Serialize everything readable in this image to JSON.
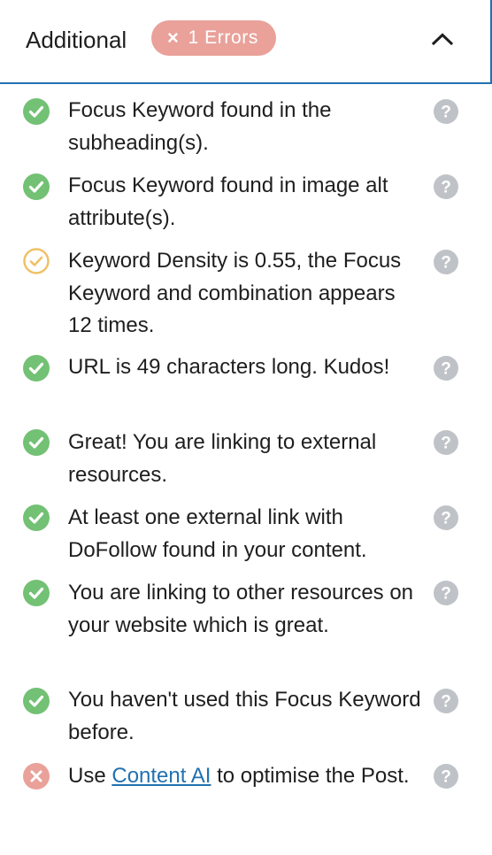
{
  "header": {
    "title": "Additional",
    "error_badge": {
      "icon": "x-icon",
      "label": "1 Errors",
      "color": "#e9a19a"
    },
    "collapse_icon": "chevron-up-icon",
    "border_color": "#2271b1"
  },
  "colors": {
    "ok": "#72c174",
    "warning": "#f0c167",
    "error": "#e9a19a",
    "help": "#bfc3c8",
    "link": "#2271b1"
  },
  "checks": [
    {
      "status": "ok",
      "icon": "check-circle-icon",
      "text": "Focus Keyword found in the subheading(s)."
    },
    {
      "status": "ok",
      "icon": "check-circle-icon",
      "text": "Focus Keyword found in image alt attribute(s)."
    },
    {
      "status": "warning",
      "icon": "warning-circle-icon",
      "text": "Keyword Density is 0.55, the Focus Keyword and combination appears 12 times."
    },
    {
      "status": "ok",
      "icon": "check-circle-icon",
      "text": "URL is 49 characters long. Kudos!"
    },
    {
      "status": "ok",
      "icon": "check-circle-icon",
      "text": "Great! You are linking to external resources."
    },
    {
      "status": "ok",
      "icon": "check-circle-icon",
      "text": "At least one external link with DoFollow found in your content."
    },
    {
      "status": "ok",
      "icon": "check-circle-icon",
      "text": "You are linking to other resources on your website which is great."
    },
    {
      "status": "ok",
      "icon": "check-circle-icon",
      "text": "You haven't used this Focus Keyword before."
    },
    {
      "status": "error",
      "icon": "error-circle-icon",
      "text_before": "Use",
      "link_text": "Content AI",
      "text_after": "to optimise the Post."
    }
  ],
  "help_icon": "question-circle-icon"
}
